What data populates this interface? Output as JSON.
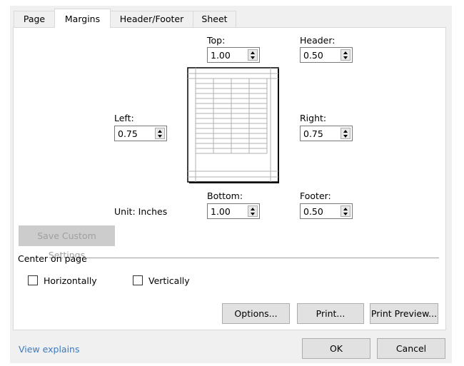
{
  "tabs": [
    {
      "label": "Page"
    },
    {
      "label": "Margins",
      "selected": true
    },
    {
      "label": "Header/Footer"
    },
    {
      "label": "Sheet"
    }
  ],
  "margins": {
    "top": {
      "label": "Top:",
      "value": "1.00"
    },
    "header": {
      "label": "Header:",
      "value": "0.50"
    },
    "left": {
      "label": "Left:",
      "value": "0.75"
    },
    "right": {
      "label": "Right:",
      "value": "0.75"
    },
    "bottom": {
      "label": "Bottom:",
      "value": "1.00"
    },
    "footer": {
      "label": "Footer:",
      "value": "0.50"
    },
    "unit": "Unit: Inches"
  },
  "save_custom_label": "Save Custom Settings",
  "center": {
    "title": "Center on page",
    "horizontally": {
      "label": "Horizontally",
      "checked": false
    },
    "vertically": {
      "label": "Vertically",
      "checked": false
    }
  },
  "buttons": {
    "options": "Options...",
    "print": "Print...",
    "print_preview": "Print Preview...",
    "ok": "OK",
    "cancel": "Cancel"
  },
  "link": "View explains",
  "colors": {
    "link": "#3b7ac0",
    "dialog_bg": "#f0f0f0"
  }
}
